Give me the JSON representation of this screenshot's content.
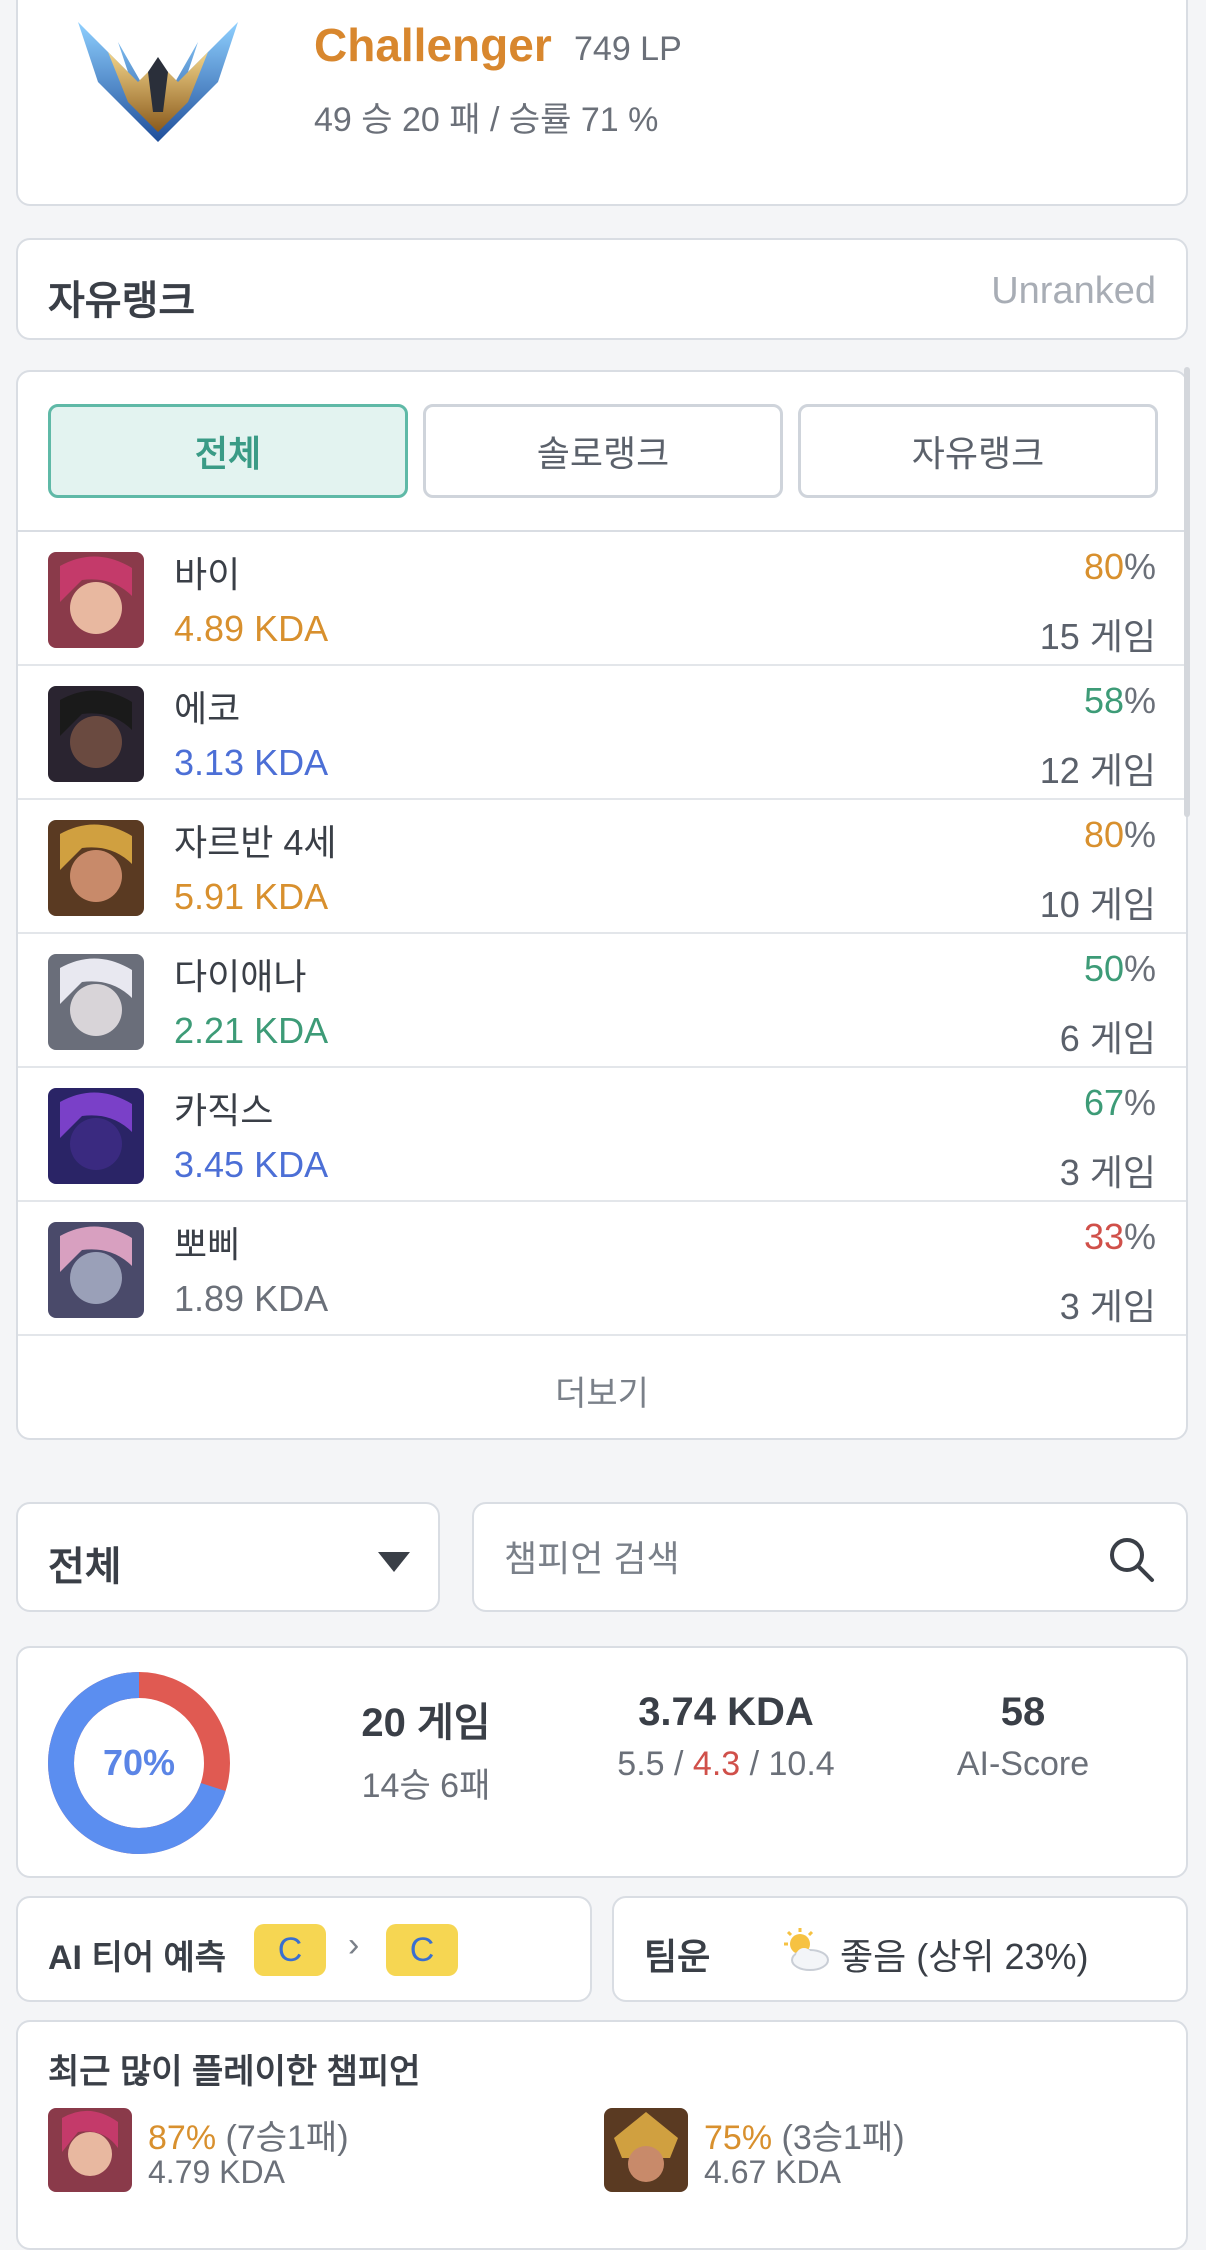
{
  "solo_rank": {
    "tier": "Challenger",
    "lp": "749 LP",
    "record": "49 승 20 패 / 승률 71 %"
  },
  "flex_rank": {
    "title": "자유랭크",
    "status": "Unranked"
  },
  "champ_tabs": [
    "전체",
    "솔로랭크",
    "자유랭크"
  ],
  "champions": [
    {
      "name": "바이",
      "kda": "4.89 KDA",
      "kda_color": "orange",
      "winrate": "80",
      "winrate_color": "orange",
      "games": "15 게임"
    },
    {
      "name": "에코",
      "kda": "3.13 KDA",
      "kda_color": "blue",
      "winrate": "58",
      "winrate_color": "green",
      "games": "12 게임"
    },
    {
      "name": "자르반 4세",
      "kda": "5.91 KDA",
      "kda_color": "orange",
      "winrate": "80",
      "winrate_color": "orange",
      "games": "10 게임"
    },
    {
      "name": "다이애나",
      "kda": "2.21 KDA",
      "kda_color": "green",
      "winrate": "50",
      "winrate_color": "green",
      "games": "6 게임"
    },
    {
      "name": "카직스",
      "kda": "3.45 KDA",
      "kda_color": "blue",
      "winrate": "67",
      "winrate_color": "green",
      "games": "3 게임"
    },
    {
      "name": "뽀삐",
      "kda": "1.89 KDA",
      "kda_color": "gray",
      "winrate": "33",
      "winrate_color": "red",
      "games": "3 게임"
    }
  ],
  "more_label": "더보기",
  "filter": {
    "selected": "전체"
  },
  "search": {
    "placeholder": "챔피언 검색"
  },
  "summary": {
    "winrate_label": "70%",
    "winrate_value": 70,
    "games": "20 게임",
    "record": "14승 6패",
    "kda": "3.74 KDA",
    "kills": "5.5",
    "deaths": "4.3",
    "assists": "10.4",
    "ai_score": "58",
    "ai_score_label": "AI-Score"
  },
  "ai_tier": {
    "label": "AI 티어 예측",
    "from": "C",
    "to": "C"
  },
  "team_luck": {
    "label": "팀운",
    "value": "좋음 (상위 23%)"
  },
  "recent": {
    "title": "최근 많이 플레이한 챔피언",
    "items": [
      {
        "winrate": "87%",
        "record": "(7승1패)",
        "kda": "4.79 KDA"
      },
      {
        "winrate": "75%",
        "record": "(3승1패)",
        "kda": "4.67 KDA"
      }
    ]
  },
  "colors": {
    "accent": "#5fb9a7",
    "orange": "#d8902e",
    "green": "#3d9b77",
    "blue": "#4c6fd6",
    "red": "#d0504a",
    "donut_win": "#5b8ef0",
    "donut_loss": "#e05a52"
  }
}
